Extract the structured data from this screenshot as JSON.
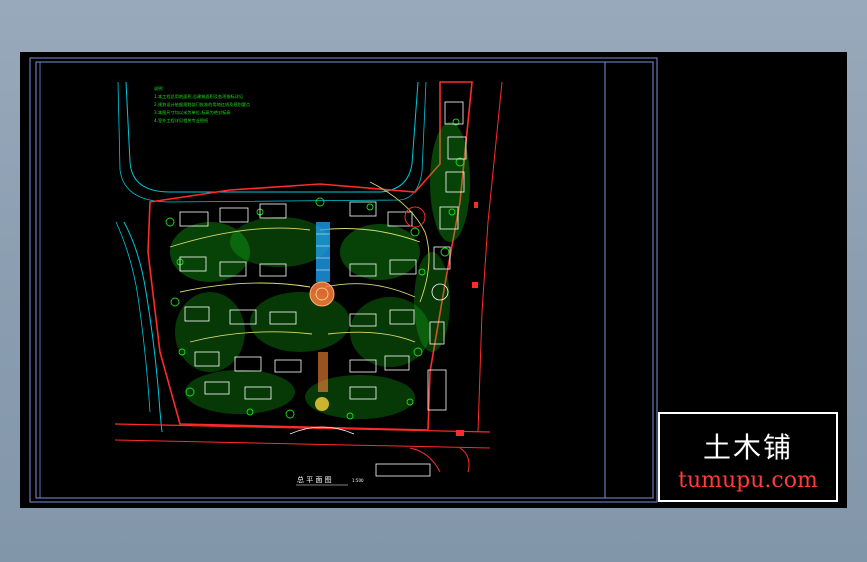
{
  "drawing": {
    "title": "总 平 面 图",
    "scale": "1:500",
    "notes": [
      "说明:",
      "1.本工程总用地面积,总建筑面积及各项指标详见",
      "2.规划设计依据规划部门批准的用地红线及规划要点",
      "3.本图尺寸均以米为单位,标高为绝对标高",
      "4.室外工程详见相关专业图纸"
    ]
  },
  "watermark": {
    "chinese": "土木铺",
    "url": "tumupu.com"
  },
  "colors": {
    "background": "#000000",
    "desktop": "#8fa2b5",
    "boundary": "#ff2a2a",
    "vegetation": "#19e019",
    "road": "#00c8d8",
    "building": "#ffffff",
    "plaza": "#ff7a3a",
    "watermark_url": "#ff3b3b"
  }
}
